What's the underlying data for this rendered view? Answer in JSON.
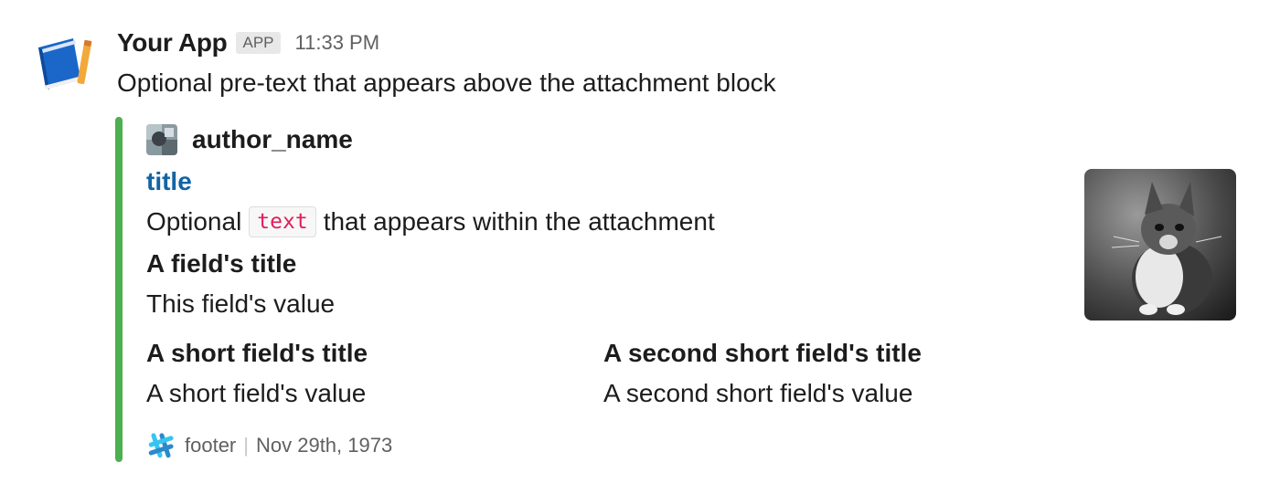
{
  "message": {
    "app_name": "Your App",
    "app_badge": "APP",
    "timestamp": "11:33 PM",
    "pretext": "Optional pre-text that appears above the attachment block",
    "app_icon": "book-pencil-icon"
  },
  "attachment": {
    "color": "#4caf50",
    "author_icon": "author-photo-icon",
    "author_name": "author_name",
    "title": "title",
    "text_before": "Optional",
    "text_code": "text",
    "text_after": "that appears within the attachment",
    "fields": [
      {
        "title": "A field's title",
        "value": "This field's value"
      },
      {
        "title": "A short field's title",
        "value": "A short field's value"
      },
      {
        "title": "A second short field's title",
        "value": "A second short field's value"
      }
    ],
    "thumb": "kitten-photo",
    "footer_icon": "slack-hash-icon",
    "footer": "footer",
    "footer_separator": "|",
    "footer_date": "Nov 29th, 1973"
  }
}
